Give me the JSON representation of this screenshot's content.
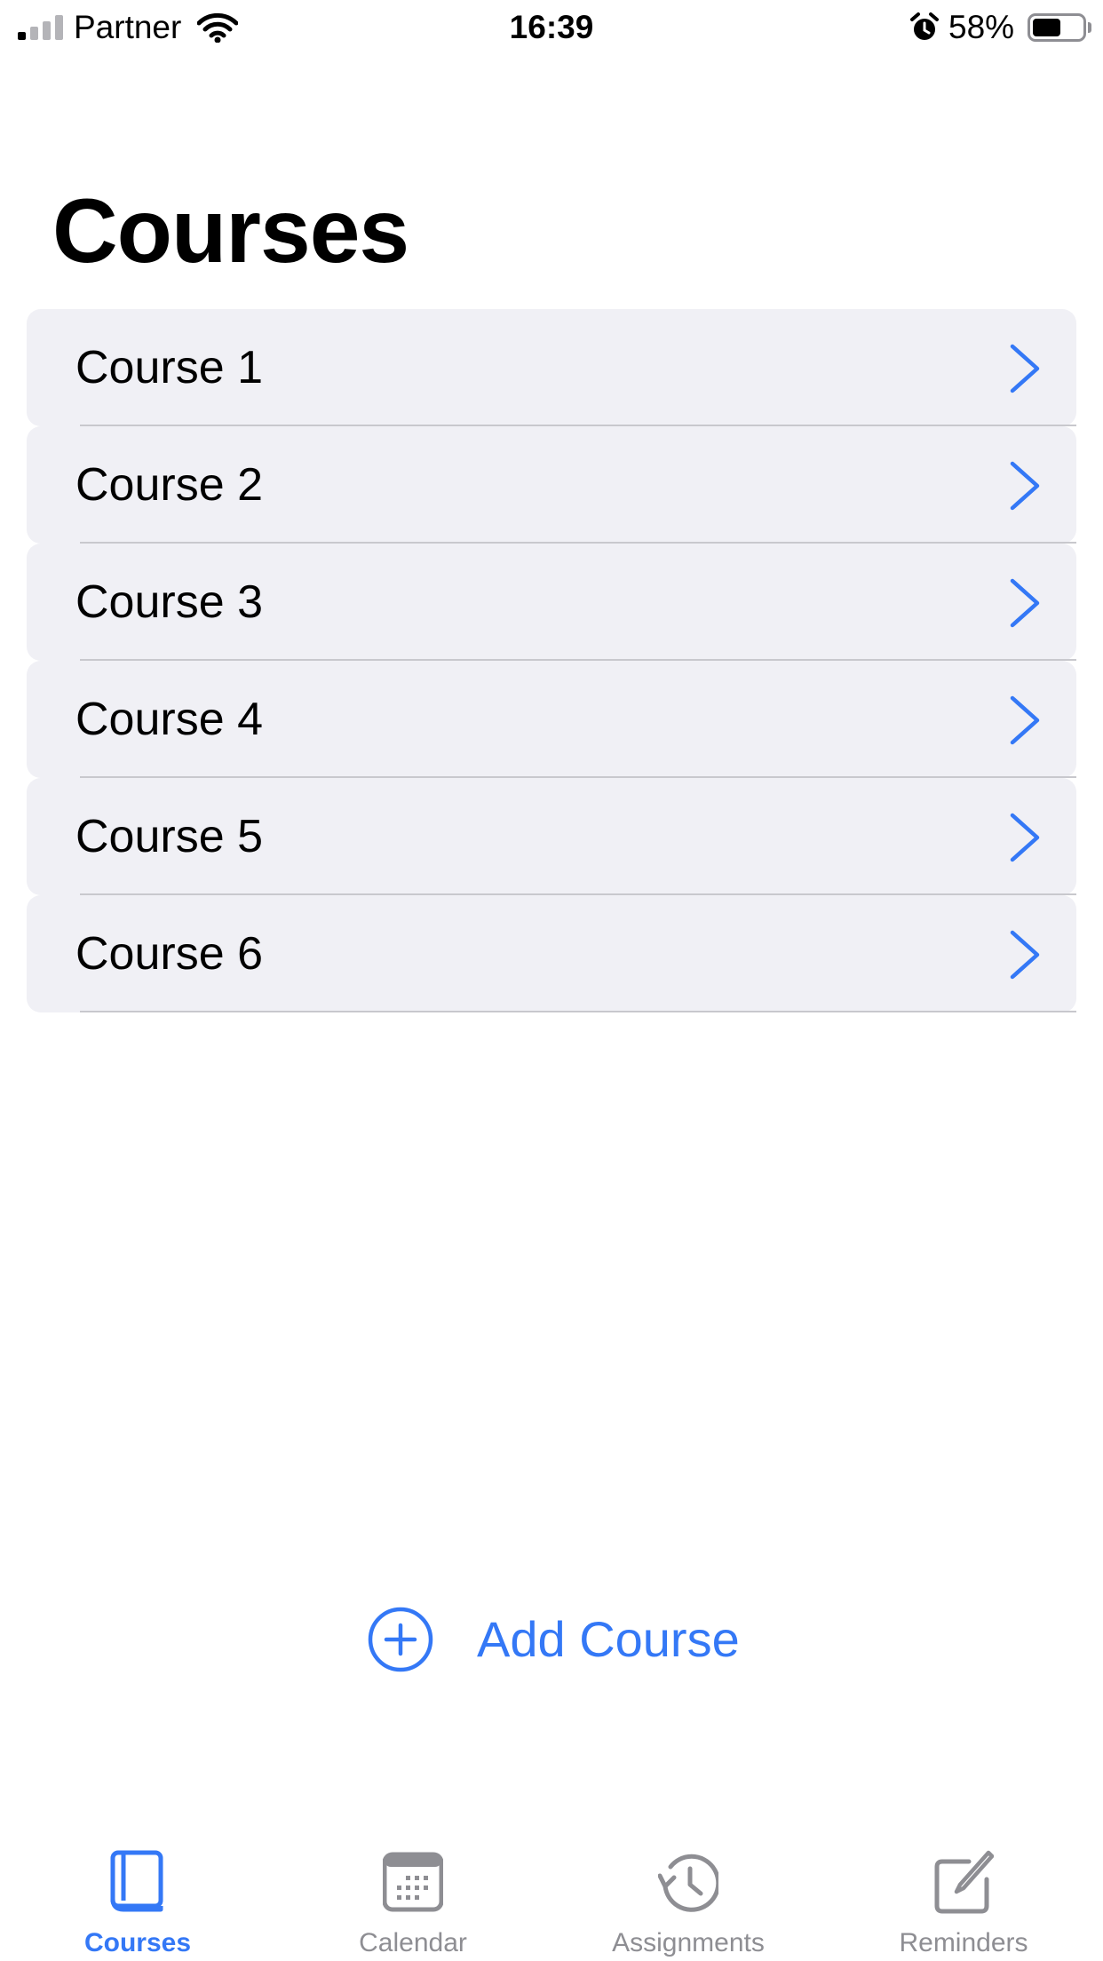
{
  "status_bar": {
    "carrier": "Partner",
    "time": "16:39",
    "battery_percent": "58%",
    "battery_level": 0.58,
    "signal_bars_active": 1,
    "signal_bars_total": 4
  },
  "header": {
    "title": "Courses"
  },
  "courses": [
    {
      "label": "Course 1"
    },
    {
      "label": "Course 2"
    },
    {
      "label": "Course 3"
    },
    {
      "label": "Course 4"
    },
    {
      "label": "Course 5"
    },
    {
      "label": "Course 6"
    }
  ],
  "add_course": {
    "label": "Add Course",
    "icon": "plus-circle-icon"
  },
  "tab_bar": {
    "active_tab": "Courses",
    "tabs": [
      {
        "label": "Courses",
        "icon": "book-icon"
      },
      {
        "label": "Calendar",
        "icon": "calendar-icon"
      },
      {
        "label": "Assignments",
        "icon": "history-clock-icon"
      },
      {
        "label": "Reminders",
        "icon": "compose-icon"
      }
    ]
  },
  "colors": {
    "accent": "#3478f6",
    "row_background": "#f0f0f5",
    "separator": "#c8c8cd",
    "inactive_tab": "#8e8e93"
  }
}
